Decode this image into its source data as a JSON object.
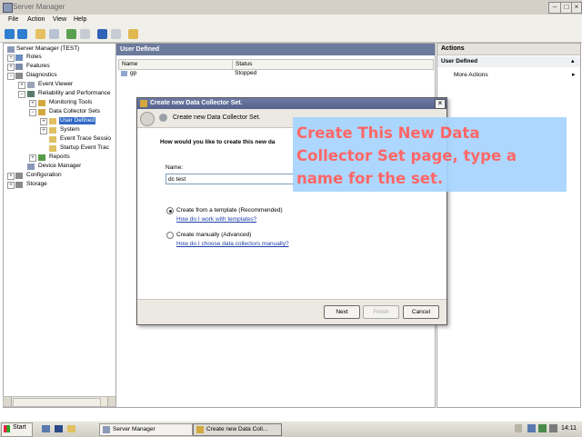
{
  "window": {
    "title": "Server Manager"
  },
  "menu": [
    "File",
    "Action",
    "View",
    "Help"
  ],
  "tree": {
    "items": [
      "Server Manager (TEST)",
      "Roles",
      "Features",
      "Diagnostics",
      "Event Viewer",
      "Reliability and Performance",
      "Monitoring Tools",
      "Data Collector Sets",
      "User Defined",
      "System",
      "Event Trace Sessio",
      "Startup Event Trac",
      "Reports",
      "Device Manager",
      "Configuration",
      "Storage"
    ]
  },
  "center": {
    "header": "User Defined",
    "columns": [
      "Name",
      "Status"
    ],
    "rows": [
      {
        "name": "gp",
        "status": "Stopped"
      }
    ]
  },
  "actions": {
    "header": "Actions",
    "section": "User Defined",
    "more": "More Actions"
  },
  "dialog": {
    "title": "Create new Data Collector Set.",
    "heading": "Create new Data Collector Set.",
    "question": "How would you like to create this new da",
    "name_label": "Name:",
    "name_value": "dc test",
    "option_template": "Create from a template (Recommended)",
    "link_template": "How do I work with templates?",
    "option_manual": "Create manually (Advanced)",
    "link_manual": "How do I choose data collectors manually?",
    "buttons": {
      "next": "Next",
      "finish": "Finish",
      "cancel": "Cancel"
    }
  },
  "callout": {
    "text": "Create This New Data Collector Set page, type a name for the set."
  },
  "taskbar": {
    "start": "Start",
    "tasks": [
      "Server Manager",
      "Create new Data Coll..."
    ],
    "clock": "14:11"
  }
}
